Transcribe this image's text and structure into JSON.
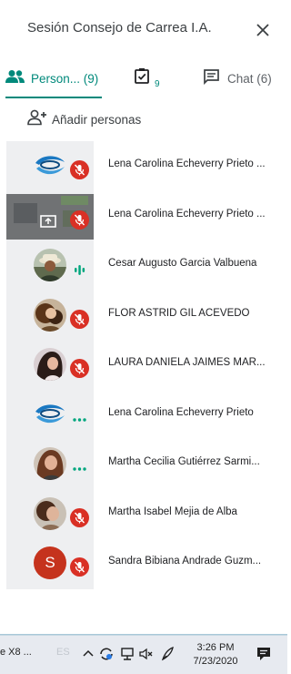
{
  "header": {
    "title": "Sesión Consejo de Carrea I.A.",
    "close_icon": "close-icon"
  },
  "tabs": {
    "people": {
      "label": "Person...",
      "count": "(9)",
      "icon": "people-icon"
    },
    "tasks": {
      "count": "9",
      "icon": "task-checkbox-icon"
    },
    "chat": {
      "label": "Chat",
      "count": "(6)",
      "icon": "chat-icon"
    }
  },
  "add_people": {
    "label": "Añadir personas",
    "icon": "add-person-icon"
  },
  "participants": [
    {
      "name": "Lena Carolina Echeverry Prieto ...",
      "avatar": "logo-swirl",
      "status": "muted"
    },
    {
      "name": "Lena Carolina Echeverry Prieto ...",
      "avatar": "presentation",
      "status": "muted"
    },
    {
      "name": "Cesar Augusto Garcia Valbuena",
      "avatar": "photo",
      "status": "speaking"
    },
    {
      "name": "FLOR ASTRID GIL ACEVEDO",
      "avatar": "photo",
      "status": "muted"
    },
    {
      "name": "LAURA DANIELA JAIMES MAR...",
      "avatar": "photo",
      "status": "muted"
    },
    {
      "name": "Lena Carolina Echeverry Prieto",
      "avatar": "logo-swirl",
      "status": "idle"
    },
    {
      "name": "Martha Cecilia Gutiérrez Sarmi...",
      "avatar": "photo",
      "status": "idle"
    },
    {
      "name": "Martha Isabel Mejia de Alba",
      "avatar": "photo",
      "status": "muted"
    },
    {
      "name": "Sandra Bibiana Andrade Guzm...",
      "avatar": "letter",
      "letter": "S",
      "status": "muted"
    }
  ],
  "taskbar": {
    "app_label": "e X8 ...",
    "lang": "ES",
    "time": "3:26 PM",
    "date": "7/23/2020"
  },
  "colors": {
    "accent": "#00897b",
    "mute": "#d93025",
    "avatar_letter_bg": "#c5331d"
  }
}
